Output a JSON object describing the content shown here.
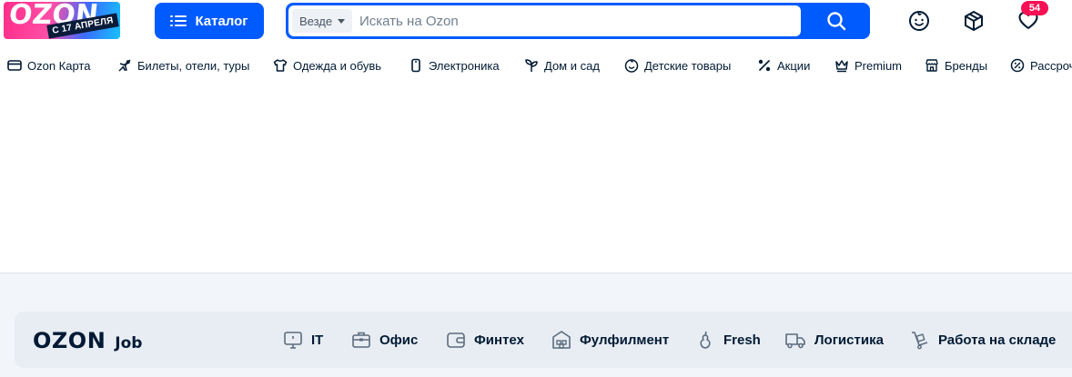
{
  "header": {
    "logo_text": "OZON",
    "logo_date": "С 17 АПРЕЛЯ",
    "catalog_label": "Каталог",
    "search_scope": "Везде",
    "search_placeholder": "Искать на Ozon",
    "favorites_count": "54"
  },
  "nav": {
    "items": [
      {
        "label": "Ozon Карта",
        "icon": "card-icon"
      },
      {
        "label": "Билеты, отели, туры",
        "icon": "plane-icon"
      },
      {
        "label": "Одежда и обувь",
        "icon": "tshirt-icon"
      },
      {
        "label": "Электроника",
        "icon": "phone-icon"
      },
      {
        "label": "Дом и сад",
        "icon": "plant-icon"
      },
      {
        "label": "Детские товары",
        "icon": "baby-icon"
      },
      {
        "label": "Акции",
        "icon": "percent-icon"
      },
      {
        "label": "Premium",
        "icon": "crown-icon"
      },
      {
        "label": "Бренды",
        "icon": "store-icon"
      },
      {
        "label": "Рассроч",
        "icon": "installment-icon"
      }
    ]
  },
  "footer": {
    "job_logo": "OZON",
    "job_word": "Job",
    "items": [
      {
        "label": "IT",
        "icon": "monitor-icon"
      },
      {
        "label": "Офис",
        "icon": "briefcase-icon"
      },
      {
        "label": "Финтех",
        "icon": "wallet-icon"
      },
      {
        "label": "Фулфилмент",
        "icon": "warehouse-icon"
      },
      {
        "label": "Fresh",
        "icon": "pear-icon"
      },
      {
        "label": "Логистика",
        "icon": "truck-icon"
      },
      {
        "label": "Работа на складе",
        "icon": "trolley-icon"
      }
    ]
  },
  "colors": {
    "brand_blue": "#005bff",
    "badge_pink": "#f91155",
    "text_dark": "#001a34",
    "footer_bg": "#f2f5f9"
  }
}
